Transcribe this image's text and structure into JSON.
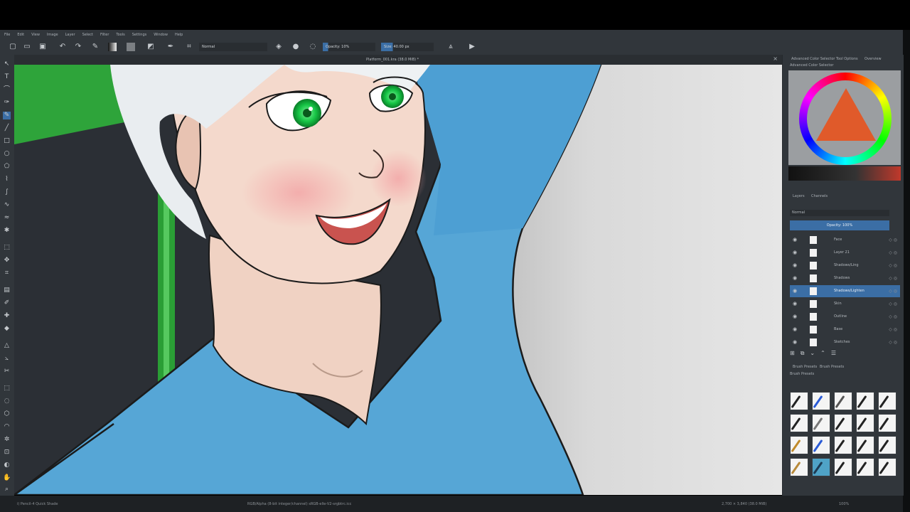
{
  "menu": [
    "File",
    "Edit",
    "View",
    "Image",
    "Layer",
    "Select",
    "Filter",
    "Tools",
    "Settings",
    "Window",
    "Help"
  ],
  "toolbar": {
    "blend_mode": "Normal",
    "opacity": "Opacity: 10%",
    "size": "Size: 40.00 px"
  },
  "document_tab": "Platform_001.kra (38.0 MiB) *",
  "dock": {
    "tabs": [
      "Advanced Color Selector",
      "Tool Options",
      "Overview"
    ],
    "color_title": "Advanced Color Selector",
    "layers_tabs": [
      "Layers",
      "Channels"
    ],
    "blend": "Normal",
    "opacity": "Opacity: 100%",
    "layers": [
      {
        "name": "Face",
        "selected": false
      },
      {
        "name": "Layer 21",
        "selected": false
      },
      {
        "name": "Shadows/Ling",
        "selected": false
      },
      {
        "name": "Shadows",
        "selected": false
      },
      {
        "name": "Shadows/Lighten",
        "selected": true
      },
      {
        "name": "Skin",
        "selected": false
      },
      {
        "name": "Outline",
        "selected": false
      },
      {
        "name": "Base",
        "selected": false
      },
      {
        "name": "Sketches",
        "selected": false
      }
    ],
    "brush_presets_title": "Brush Presets",
    "brush_tag": "Brush Presets",
    "brush_filter": "Brush Presets"
  },
  "status": {
    "brush": "i) Pencil-4 Quick Shade",
    "color_info": "RGB/Alpha (8-bit integer/channel)  sRGB-elle-V2-srgbtrc.icc",
    "size_info": "2,700 × 3,840 (38.0 MiB)",
    "zoom": "100%"
  },
  "colors": {
    "ui_bg": "#31363b",
    "selection": "#3b6ea5",
    "shirt": "#56a6d6",
    "eyes": "#1fc04a",
    "hair": "#e9edf0",
    "skin": "#f2d4c4",
    "green_bg": "#2ea43a"
  }
}
